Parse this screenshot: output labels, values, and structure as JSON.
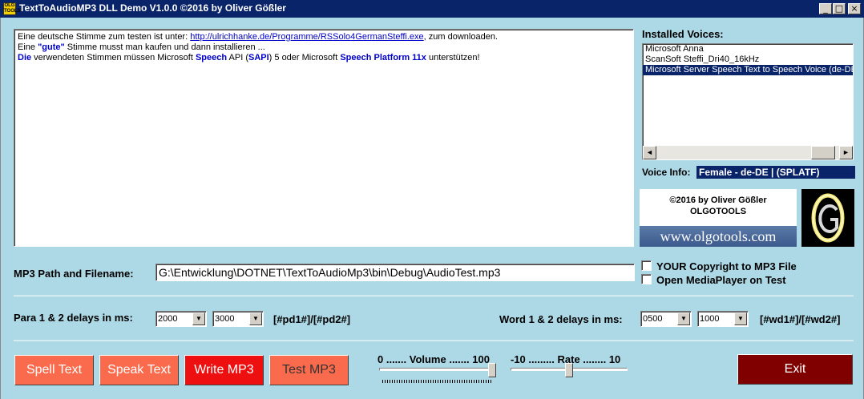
{
  "window": {
    "icon_text": "OLG TOOLS",
    "title": "TextToAudioMP3 DLL Demo V1.0.0 ©2016 by Oliver Gößler",
    "controls": [
      "_",
      "□",
      "×"
    ]
  },
  "text_area": {
    "line1_prefix": "Eine deutsche Stimme zum testen ist unter: ",
    "line1_link": "http://ulrichhanke.de/Programme/RSSolo4GermanSteffi.exe",
    "line1_suffix": ", zum downloaden.",
    "line2_prefix": "Eine ",
    "line2_bold": "\"gute\"",
    "line2_suffix": " Stimme musst man kaufen und dann installieren ...",
    "line3_die": "Die",
    "line3_a": " verwendeten Stimmen müssen Microsoft ",
    "line3_speech": "Speech",
    "line3_b": " API (",
    "line3_sapi": "SAPI",
    "line3_c": ") 5 oder Microsoft ",
    "line3_platform": "Speech Platform 11x",
    "line3_d": " unterstützen!"
  },
  "voices": {
    "title": "Installed Voices:",
    "items": [
      {
        "label": "Microsoft Anna",
        "selected": false
      },
      {
        "label": "ScanSoft Steffi_Dri40_16kHz",
        "selected": false
      },
      {
        "label": "Microsoft Server Speech Text to Speech Voice (de-DE",
        "selected": true
      }
    ],
    "scroll_left": "◄",
    "scroll_right": "►"
  },
  "voice_info": {
    "label": "Voice Info:",
    "value": "Female - de-DE | (SPLATF)"
  },
  "banner": {
    "line1": "©2016 by Oliver Gößler",
    "line2": "OLGOTOOLS",
    "url": "www.olgotools.com"
  },
  "mp3": {
    "label": "MP3 Path and Filename:",
    "path": "G:\\Entwicklung\\DOTNET\\TextToAudioMp3\\bin\\Debug\\AudioTest.mp3"
  },
  "options": {
    "copyright": {
      "label": "YOUR Copyright to MP3 File",
      "checked": false
    },
    "mediaplayer": {
      "label": "Open MediaPlayer on Test",
      "checked": false
    }
  },
  "para_delays": {
    "label": "Para 1 & 2 delays in ms:",
    "value1": "2000",
    "value2": "3000",
    "tokens": "[#pd1#]/[#pd2#]"
  },
  "word_delays": {
    "label": "Word 1 & 2 delays in ms:",
    "value1": "0500",
    "value2": "1000",
    "tokens": "[#wd1#]/[#wd2#]"
  },
  "buttons": {
    "spell": "Spell Text",
    "speak": "Speak Text",
    "write": "Write MP3",
    "test": "Test MP3",
    "exit": "Exit"
  },
  "volume": {
    "label": "0 ....... Volume ....... 100",
    "min": 0,
    "max": 100,
    "value": 100
  },
  "rate": {
    "label": "-10 ......... Rate ........ 10",
    "min": -10,
    "max": 10,
    "value": 0
  },
  "colors": {
    "button_salmon": "#fa6a4c",
    "button_red": "#ee1010",
    "button_exit": "#800000",
    "background": "#add8e6",
    "titlebar": "#0a246a"
  }
}
